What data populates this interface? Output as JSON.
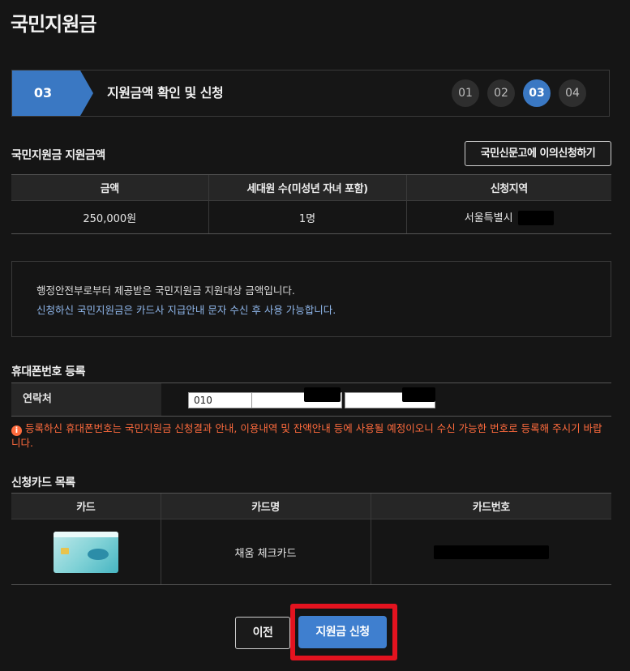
{
  "page": {
    "title": "국민지원금"
  },
  "stepbar": {
    "current": "03",
    "title": "지원금액 확인 및 신청",
    "steps": [
      "01",
      "02",
      "03",
      "04"
    ]
  },
  "amount_section": {
    "title": "국민지원금 지원금액",
    "objection_button": "국민신문고에 이의신청하기",
    "headers": [
      "금액",
      "세대원 수(미성년 자녀 포함)",
      "신청지역"
    ],
    "row": {
      "amount": "250,000원",
      "members": "1명",
      "region": "서울특별시"
    }
  },
  "info": {
    "line1": "행정안전부로부터 제공받은 국민지원금 지원대상 금액입니다.",
    "line2": "신청하신 국민지원금은 카드사 지급안내 문자 수신 후 사용 가능합니다."
  },
  "phone_section": {
    "title": "휴대폰번호 등록",
    "label": "연락처",
    "prefix": "010",
    "notice": "등록하신 휴대폰번호는 국민지원금 신청결과 안내, 이용내역 및 잔액안내 등에 사용될 예정이오니 수신 가능한 번호로 등록해 주시기 바랍니다."
  },
  "card_section": {
    "title": "신청카드 목록",
    "headers": [
      "카드",
      "카드명",
      "카드번호"
    ],
    "row": {
      "card_name": "채움 체크카드"
    }
  },
  "buttons": {
    "prev": "이전",
    "apply": "지원금 신청"
  },
  "colors": {
    "accent": "#3a78c3",
    "warning": "#ff6b3d",
    "highlight": "#e3131f"
  }
}
